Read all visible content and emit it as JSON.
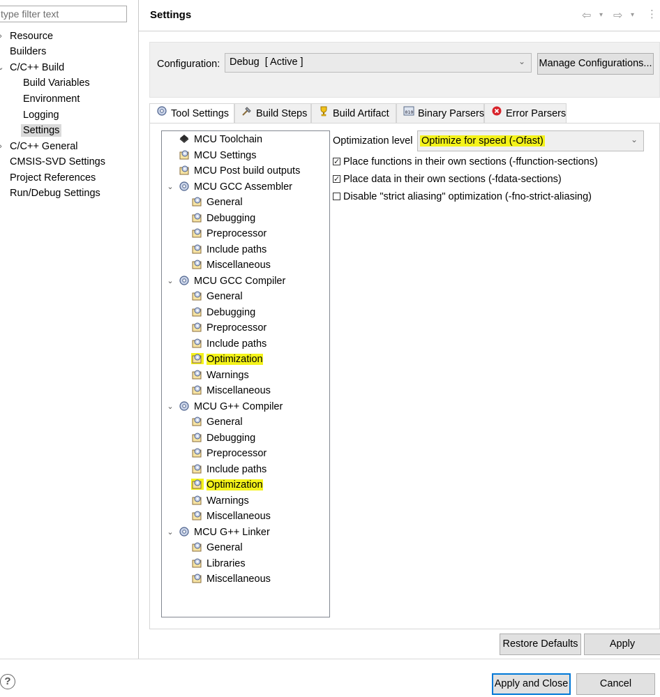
{
  "filter": {
    "placeholder": "type filter text"
  },
  "nav": {
    "items": [
      {
        "label": "Resource",
        "arrow": ">"
      },
      {
        "label": "Builders"
      },
      {
        "label": "C/C++ Build",
        "arrow": "v"
      },
      {
        "label": "Build Variables"
      },
      {
        "label": "Environment"
      },
      {
        "label": "Logging"
      },
      {
        "label": "Settings"
      },
      {
        "label": "C/C++ General",
        "arrow": ">"
      },
      {
        "label": "CMSIS-SVD Settings"
      },
      {
        "label": "Project References"
      },
      {
        "label": "Run/Debug Settings"
      }
    ]
  },
  "header": {
    "title": "Settings",
    "icons": [
      "back-arrow-icon",
      "back-menu-icon",
      "forward-arrow-icon",
      "forward-menu-icon",
      "view-menu-icon"
    ]
  },
  "config": {
    "label": "Configuration:",
    "value": "Debug  [ Active ]",
    "manage_label": "Manage Configurations..."
  },
  "tabs": [
    {
      "label": "Tool Settings",
      "icon": "tool-settings-icon",
      "active": true
    },
    {
      "label": "Build Steps",
      "icon": "build-steps-icon"
    },
    {
      "label": "Build Artifact",
      "icon": "build-artifact-icon"
    },
    {
      "label": "Binary Parsers",
      "icon": "binary-parsers-icon"
    },
    {
      "label": "Error Parsers",
      "icon": "error-parsers-icon"
    }
  ],
  "tree": [
    {
      "label": "MCU Toolchain",
      "icon": "chip-icon"
    },
    {
      "label": "MCU Settings",
      "icon": "tool-option-icon"
    },
    {
      "label": "MCU Post build outputs",
      "icon": "tool-option-icon"
    },
    {
      "label": "MCU GCC Assembler",
      "icon": "tool-gear-icon",
      "expanded": true
    },
    {
      "label": "General"
    },
    {
      "label": "Debugging"
    },
    {
      "label": "Preprocessor"
    },
    {
      "label": "Include paths"
    },
    {
      "label": "Miscellaneous"
    },
    {
      "label": "MCU GCC Compiler",
      "icon": "tool-gear-icon",
      "expanded": true
    },
    {
      "label": "General"
    },
    {
      "label": "Debugging"
    },
    {
      "label": "Preprocessor"
    },
    {
      "label": "Include paths"
    },
    {
      "label": "Optimization",
      "highlighted": true
    },
    {
      "label": "Warnings"
    },
    {
      "label": "Miscellaneous"
    },
    {
      "label": "MCU G++ Compiler",
      "icon": "tool-gear-icon",
      "expanded": true
    },
    {
      "label": "General"
    },
    {
      "label": "Debugging"
    },
    {
      "label": "Preprocessor"
    },
    {
      "label": "Include paths"
    },
    {
      "label": "Optimization",
      "highlighted": true
    },
    {
      "label": "Warnings"
    },
    {
      "label": "Miscellaneous"
    },
    {
      "label": "MCU G++ Linker",
      "icon": "tool-gear-icon",
      "expanded": true
    },
    {
      "label": "General"
    },
    {
      "label": "Libraries"
    },
    {
      "label": "Miscellaneous"
    }
  ],
  "options": {
    "level_label": "Optimization level",
    "level_value": "Optimize for speed (-Ofast)",
    "checkboxes": [
      {
        "label": "Place functions in their own sections (-ffunction-sections)",
        "checked": true
      },
      {
        "label": "Place data in their own sections (-fdata-sections)",
        "checked": true
      },
      {
        "label": "Disable \"strict aliasing\" optimization (-fno-strict-aliasing)",
        "checked": false
      }
    ]
  },
  "buttons": {
    "restore_defaults": "Restore Defaults",
    "apply": "Apply",
    "apply_and_close": "Apply and Close",
    "cancel": "Cancel"
  },
  "colors": {
    "highlight": "#f4f31a",
    "focus_border": "#0078d7"
  }
}
